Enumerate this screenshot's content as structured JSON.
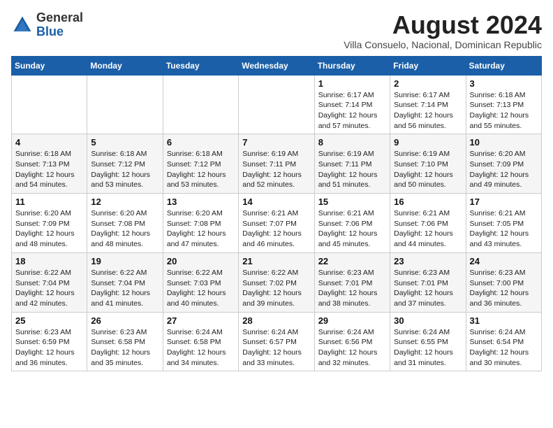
{
  "logo": {
    "general": "General",
    "blue": "Blue"
  },
  "title": "August 2024",
  "subtitle": "Villa Consuelo, Nacional, Dominican Republic",
  "header_days": [
    "Sunday",
    "Monday",
    "Tuesday",
    "Wednesday",
    "Thursday",
    "Friday",
    "Saturday"
  ],
  "weeks": [
    [
      {
        "day": "",
        "info": ""
      },
      {
        "day": "",
        "info": ""
      },
      {
        "day": "",
        "info": ""
      },
      {
        "day": "",
        "info": ""
      },
      {
        "day": "1",
        "info": "Sunrise: 6:17 AM\nSunset: 7:14 PM\nDaylight: 12 hours\nand 57 minutes."
      },
      {
        "day": "2",
        "info": "Sunrise: 6:17 AM\nSunset: 7:14 PM\nDaylight: 12 hours\nand 56 minutes."
      },
      {
        "day": "3",
        "info": "Sunrise: 6:18 AM\nSunset: 7:13 PM\nDaylight: 12 hours\nand 55 minutes."
      }
    ],
    [
      {
        "day": "4",
        "info": "Sunrise: 6:18 AM\nSunset: 7:13 PM\nDaylight: 12 hours\nand 54 minutes."
      },
      {
        "day": "5",
        "info": "Sunrise: 6:18 AM\nSunset: 7:12 PM\nDaylight: 12 hours\nand 53 minutes."
      },
      {
        "day": "6",
        "info": "Sunrise: 6:18 AM\nSunset: 7:12 PM\nDaylight: 12 hours\nand 53 minutes."
      },
      {
        "day": "7",
        "info": "Sunrise: 6:19 AM\nSunset: 7:11 PM\nDaylight: 12 hours\nand 52 minutes."
      },
      {
        "day": "8",
        "info": "Sunrise: 6:19 AM\nSunset: 7:11 PM\nDaylight: 12 hours\nand 51 minutes."
      },
      {
        "day": "9",
        "info": "Sunrise: 6:19 AM\nSunset: 7:10 PM\nDaylight: 12 hours\nand 50 minutes."
      },
      {
        "day": "10",
        "info": "Sunrise: 6:20 AM\nSunset: 7:09 PM\nDaylight: 12 hours\nand 49 minutes."
      }
    ],
    [
      {
        "day": "11",
        "info": "Sunrise: 6:20 AM\nSunset: 7:09 PM\nDaylight: 12 hours\nand 48 minutes."
      },
      {
        "day": "12",
        "info": "Sunrise: 6:20 AM\nSunset: 7:08 PM\nDaylight: 12 hours\nand 48 minutes."
      },
      {
        "day": "13",
        "info": "Sunrise: 6:20 AM\nSunset: 7:08 PM\nDaylight: 12 hours\nand 47 minutes."
      },
      {
        "day": "14",
        "info": "Sunrise: 6:21 AM\nSunset: 7:07 PM\nDaylight: 12 hours\nand 46 minutes."
      },
      {
        "day": "15",
        "info": "Sunrise: 6:21 AM\nSunset: 7:06 PM\nDaylight: 12 hours\nand 45 minutes."
      },
      {
        "day": "16",
        "info": "Sunrise: 6:21 AM\nSunset: 7:06 PM\nDaylight: 12 hours\nand 44 minutes."
      },
      {
        "day": "17",
        "info": "Sunrise: 6:21 AM\nSunset: 7:05 PM\nDaylight: 12 hours\nand 43 minutes."
      }
    ],
    [
      {
        "day": "18",
        "info": "Sunrise: 6:22 AM\nSunset: 7:04 PM\nDaylight: 12 hours\nand 42 minutes."
      },
      {
        "day": "19",
        "info": "Sunrise: 6:22 AM\nSunset: 7:04 PM\nDaylight: 12 hours\nand 41 minutes."
      },
      {
        "day": "20",
        "info": "Sunrise: 6:22 AM\nSunset: 7:03 PM\nDaylight: 12 hours\nand 40 minutes."
      },
      {
        "day": "21",
        "info": "Sunrise: 6:22 AM\nSunset: 7:02 PM\nDaylight: 12 hours\nand 39 minutes."
      },
      {
        "day": "22",
        "info": "Sunrise: 6:23 AM\nSunset: 7:01 PM\nDaylight: 12 hours\nand 38 minutes."
      },
      {
        "day": "23",
        "info": "Sunrise: 6:23 AM\nSunset: 7:01 PM\nDaylight: 12 hours\nand 37 minutes."
      },
      {
        "day": "24",
        "info": "Sunrise: 6:23 AM\nSunset: 7:00 PM\nDaylight: 12 hours\nand 36 minutes."
      }
    ],
    [
      {
        "day": "25",
        "info": "Sunrise: 6:23 AM\nSunset: 6:59 PM\nDaylight: 12 hours\nand 36 minutes."
      },
      {
        "day": "26",
        "info": "Sunrise: 6:23 AM\nSunset: 6:58 PM\nDaylight: 12 hours\nand 35 minutes."
      },
      {
        "day": "27",
        "info": "Sunrise: 6:24 AM\nSunset: 6:58 PM\nDaylight: 12 hours\nand 34 minutes."
      },
      {
        "day": "28",
        "info": "Sunrise: 6:24 AM\nSunset: 6:57 PM\nDaylight: 12 hours\nand 33 minutes."
      },
      {
        "day": "29",
        "info": "Sunrise: 6:24 AM\nSunset: 6:56 PM\nDaylight: 12 hours\nand 32 minutes."
      },
      {
        "day": "30",
        "info": "Sunrise: 6:24 AM\nSunset: 6:55 PM\nDaylight: 12 hours\nand 31 minutes."
      },
      {
        "day": "31",
        "info": "Sunrise: 6:24 AM\nSunset: 6:54 PM\nDaylight: 12 hours\nand 30 minutes."
      }
    ]
  ]
}
